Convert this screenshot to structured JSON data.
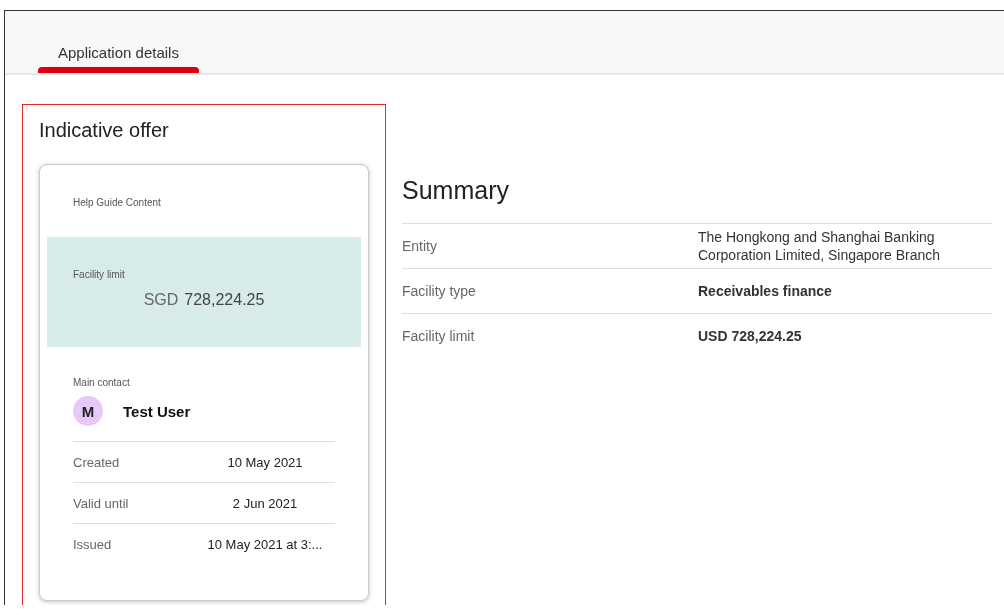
{
  "tabs": [
    {
      "label": "Application details",
      "selected": true
    }
  ],
  "offer": {
    "title": "Indicative offer",
    "help": "Help Guide Content",
    "limit": {
      "label": "Facility limit",
      "currency": "SGD",
      "amount": "728,224.25"
    },
    "contact": {
      "label": "Main contact",
      "initial": "M",
      "name": "Test User"
    },
    "details": [
      {
        "label": "Created",
        "value": "10 May 2021"
      },
      {
        "label": "Valid until",
        "value": "2 Jun 2021"
      },
      {
        "label": "Issued",
        "value": "10 May 2021 at 3:..."
      }
    ]
  },
  "summary": {
    "title": "Summary",
    "rows": [
      {
        "label": "Entity",
        "value": "The Hongkong and Shanghai Banking Corporation Limited, Singapore Branch",
        "kind": "plain"
      },
      {
        "label": "Facility type",
        "value": "Receivables finance",
        "kind": "strong"
      },
      {
        "label": "Facility limit",
        "value": "USD 728,224.25",
        "kind": "strong"
      }
    ]
  }
}
